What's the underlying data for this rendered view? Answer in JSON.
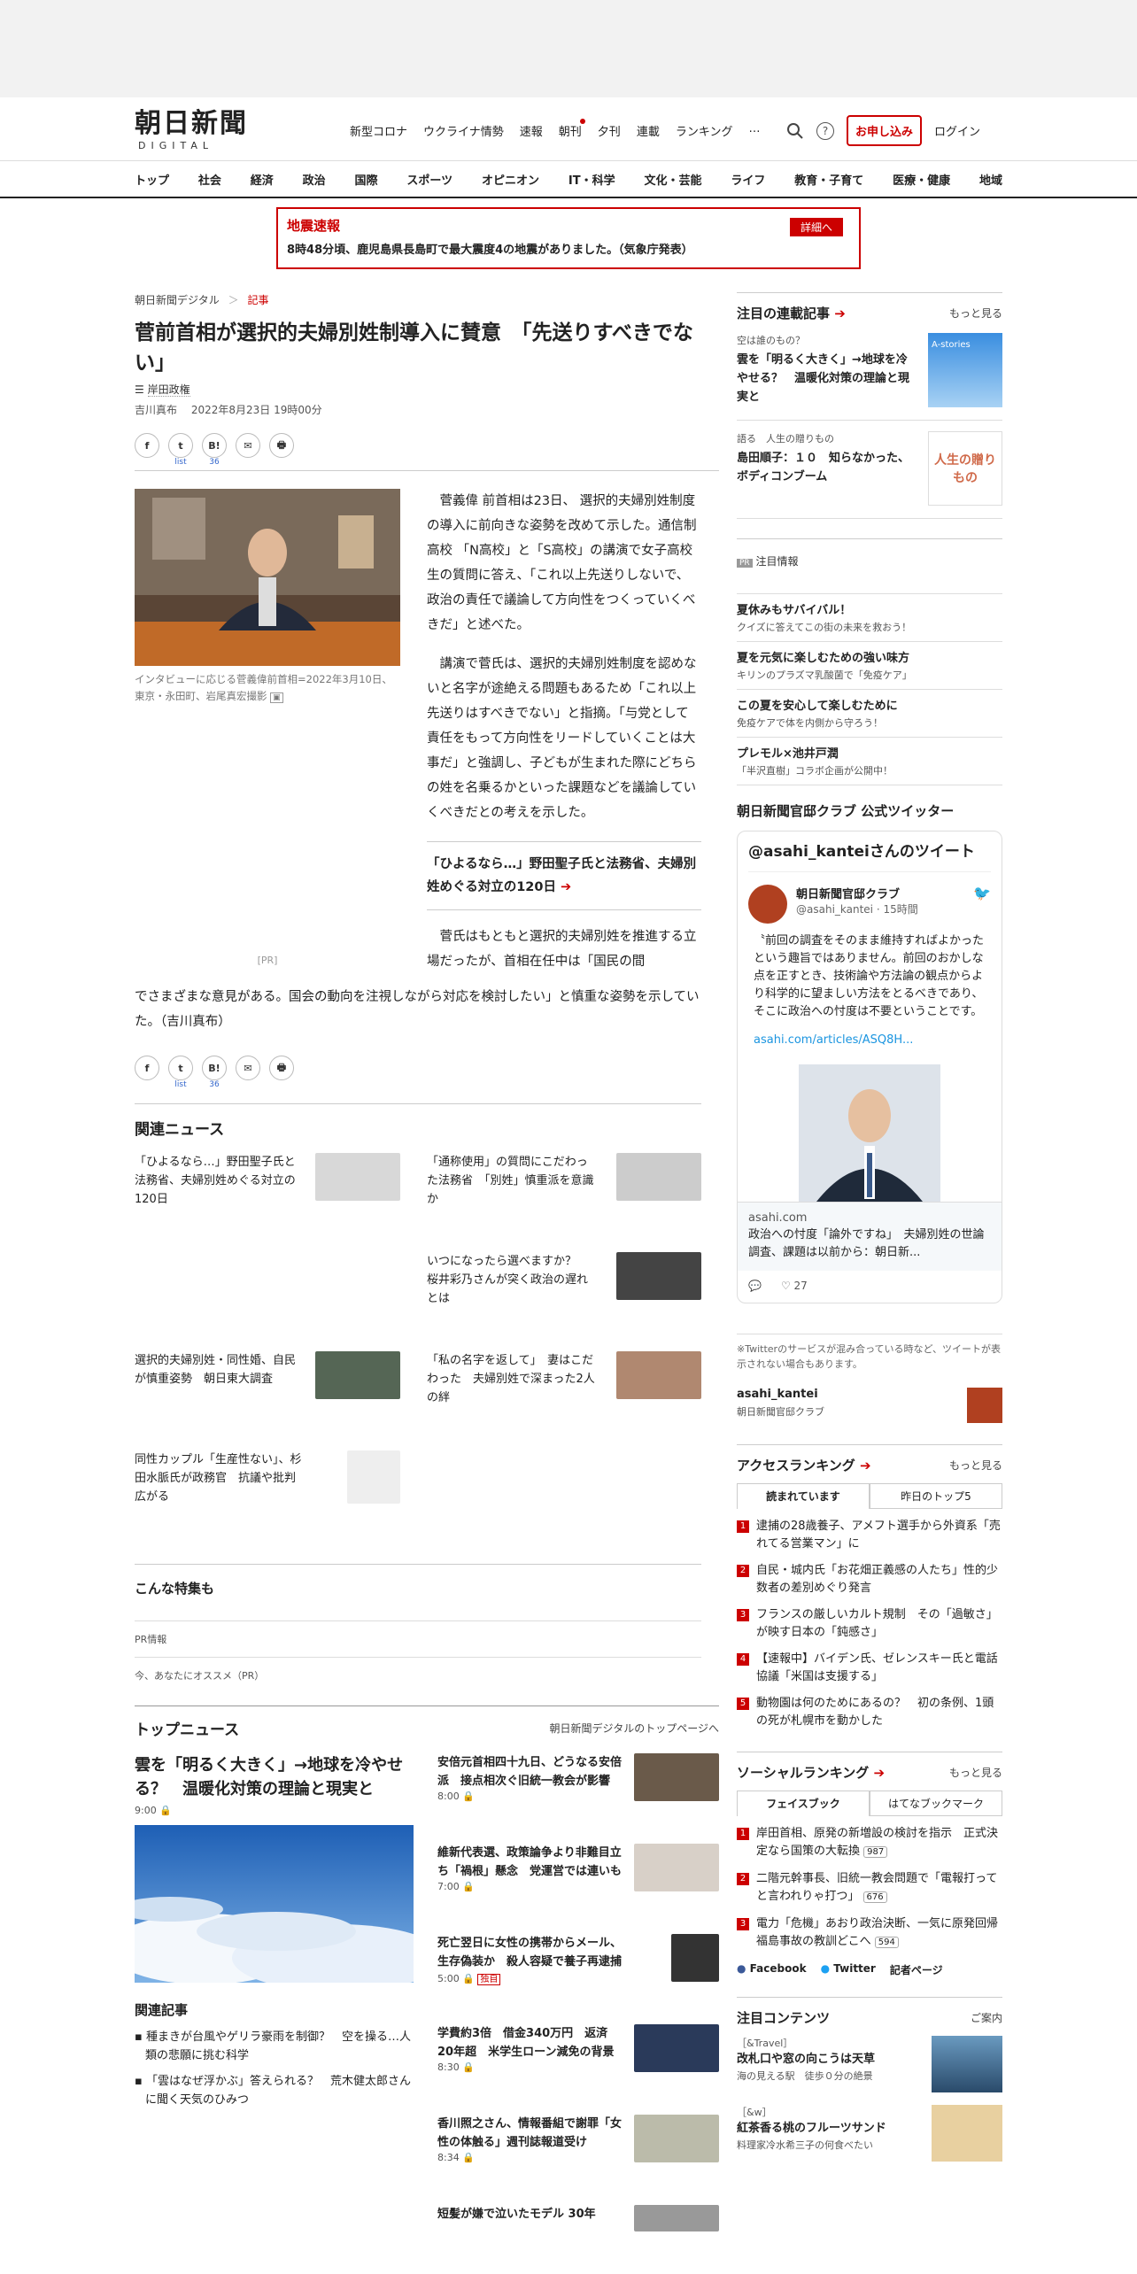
{
  "header": {
    "logo_main": "朝日新聞",
    "logo_sub": "DIGITAL",
    "nav": [
      "新型コロナ",
      "ウクライナ情勢",
      "速報",
      "朝刊",
      "夕刊",
      "連載",
      "ランキング",
      "…"
    ],
    "apply": "お申し込み",
    "login": "ログイン"
  },
  "categories": [
    "トップ",
    "社会",
    "経済",
    "政治",
    "国際",
    "スポーツ",
    "オピニオン",
    "IT・科学",
    "文化・芸能",
    "ライフ",
    "教育・子育て",
    "医療・健康",
    "地域"
  ],
  "alert": {
    "title": "地震速報",
    "button": "詳細へ",
    "text": "8時48分頃、鹿児島県長島町で最大震度4の地震がありました。（気象庁発表）"
  },
  "article": {
    "crumb_site": "朝日新聞デジタル",
    "crumb_sep": "＞",
    "crumb_section": "記事",
    "title": "菅前首相が選択的夫婦別姓制導入に賛意　「先送りすべきでない」",
    "tag": "岸田政権",
    "author": "吉川真布",
    "date": "2022年8月23日 19時00分",
    "share_icons": [
      "f",
      "t",
      "B!",
      "✉",
      "🖶"
    ],
    "share_sub_twitter": "list",
    "share_sub_hatena": "36",
    "photo_caption": "インタビューに応じる菅義偉前首相=2022年3月10日、東京・永田町、岩尾真宏撮影",
    "p1": "菅義偉 前首相は23日、 選択的夫婦別姓制度の導入に前向きな姿勢を改めて示した。通信制高校 「N高校」と「S高校」の講演で女子高校生の質問に答え、「これ以上先送りしないで、政治の責任で議論して方向性をつくっていくべきだ」と述べた。",
    "p2": "講演で菅氏は、選択的夫婦別姓制度を認めないと名字が途絶える問題もあるため「これ以上先送りはすべきでない」と指摘。「与党として責任をもって方向性をリードしていくことは大事だ」と強調し、子どもが生まれた際にどちらの姓を名乗るかといった課題などを議論していくべきだとの考えを示した。",
    "related_box": "「ひよるなら…」野田聖子氏と法務省、夫婦別姓めぐる対立の120日",
    "pr": "[PR]",
    "p3a": "菅氏はもともと選択的夫婦別姓を推進する立場だったが、首相在任中は「国民の間",
    "p3b": "でさまざまな意見がある。国会の動向を注視しながら対応を検討したい」と慎重な姿勢を示していた。（吉川真布）"
  },
  "related_news": {
    "heading": "関連ニュース",
    "items": [
      "「ひよるなら…」野田聖子氏と法務省、夫婦別姓めぐる対立の120日",
      "「通称使用」の質問にこだわった法務省　「別姓」慎重派を意識か",
      "いつになったら選べますか？　桜井彩乃さんが突く政治の遅れとは",
      "選択的夫婦別姓・同性婚、自民が慎重姿勢　朝日東大調査",
      "「私の名字を返して」　妻はこだわった　夫婦別姓で深まった2人の絆",
      "同性カップル「生産性ない」、杉田水脈氏が政務官　抗議や批判広がる"
    ]
  },
  "features": {
    "heading": "こんな特集も",
    "pr_info": "PR情報",
    "recommend": "今、あなたにオススメ（PR）"
  },
  "top_news": {
    "heading": "トップニュース",
    "more": "朝日新聞デジタルのトップページへ",
    "lead_title": "雲を「明るく大きく」→地球を冷やせる？　温暖化対策の理論と現実と",
    "lead_time": "9:00",
    "related_heading": "関連記事",
    "related": [
      "種まきが台風やゲリラ豪雨を制御？　空を操る…人類の悲願に挑む科学",
      "「雲はなぜ浮かぶ」答えられる？　荒木健太郎さんに聞く天気のひみつ"
    ],
    "items": [
      {
        "title": "安倍元首相四十九日、どうなる安倍派　接点相次ぐ旧統一教会が影響",
        "time": "8:00",
        "badge": ""
      },
      {
        "title": "維新代表選、政策論争より非難目立ち「禍根」懸念　党運営では連いも",
        "time": "7:00",
        "badge": ""
      },
      {
        "title": "死亡翌日に女性の携帯からメール、生存偽装か　殺人容疑で養子再逮捕",
        "time": "5:00",
        "badge": "独自"
      },
      {
        "title": "学費約3倍　借金340万円　返済20年超　米学生ローン減免の背景",
        "time": "8:30",
        "badge": ""
      },
      {
        "title": "香川照之さん、情報番組で謝罪「女性の体触る」週刊誌報道受け",
        "time": "8:34",
        "badge": ""
      },
      {
        "title": "短髪が嫌で泣いたモデル 30年",
        "time": "",
        "badge": ""
      }
    ]
  },
  "sidebar": {
    "serial_heading": "注目の連載記事",
    "serial_more": "もっと見る",
    "serials": [
      {
        "kicker": "空は誰のもの？",
        "title": "雲を「明るく大きく」→地球を冷やせる？　温暖化対策の理論と現実と",
        "thumb_label": "A-stories"
      },
      {
        "kicker": "語る　人生の贈りもの",
        "title": "島田順子：１０　知らなかった、ボディコンブーム",
        "thumb_label": "人生の贈りもの"
      }
    ],
    "promo_heading": "注目情報",
    "promo_badge": "PR",
    "promos": [
      {
        "title": "夏休みもサバイバル！",
        "sub": "クイズに答えてこの街の未来を救おう！"
      },
      {
        "title": "夏を元気に楽しむための強い味方",
        "sub": "キリンのプラズマ乳酸菌で「免疫ケア」"
      },
      {
        "title": "この夏を安心して楽しむために",
        "sub": "免疫ケアで体を内側から守ろう！"
      },
      {
        "title": "プレモル×池井戸潤",
        "sub": "「半沢直樹」コラボ企画が公開中！"
      }
    ],
    "twitter_heading": "朝日新聞官邸クラブ 公式ツイッター",
    "tw_box_title": "@asahi_kanteiさんのツイート",
    "tw_name": "朝日新聞官邸クラブ",
    "tw_handle": "@asahi_kantei · 15時間",
    "tw_text": "〝前回の調査をそのまま維持すればよかったという趣旨ではありません。前回のおかしな点を正すとき、技術論や方法論の観点からより科学的に望ましい方法をとるべきであり、そこに政治への忖度は不要ということです。",
    "tw_link": "asahi.com/articles/ASQ8H...",
    "tw_card_domain": "asahi.com",
    "tw_card_title": "政治への忖度「論外ですね」　夫婦別姓の世論調査、課題は以前から：朝日新...",
    "tw_likes": "27",
    "tw_note": "※Twitterのサービスが混み合っている時など、ツイートが表示されない場合もあります。",
    "tw_account": "asahi_kantei",
    "tw_account_sub": "朝日新聞官邸クラブ",
    "access_heading": "アクセスランキング",
    "access_more": "もっと見る",
    "access_tabs": [
      "読まれています",
      "昨日のトップ5"
    ],
    "access": [
      "逮捕の28歳養子、アメフト選手から外資系「売れてる営業マン」に",
      "自民・城内氏「お花畑正義感の人たち」性的少数者の差別めぐり発言",
      "フランスの厳しいカルト規制　その「過敏さ」が映す日本の「鈍感さ」",
      "【速報中】バイデン氏、ゼレンスキー氏と電話協議「米国は支援する」",
      "動物園は何のためにあるの？　初の条例、1頭の死が札幌市を動かした"
    ],
    "social_heading": "ソーシャルランキング",
    "social_more": "もっと見る",
    "social_tabs": [
      "フェイスブック",
      "はてなブックマーク"
    ],
    "social": [
      {
        "title": "岸田首相、原発の新増設の検討を指示　正式決定なら国策の大転換",
        "count": "987"
      },
      {
        "title": "二階元幹事長、旧統一教会問題で「電報打ってと言われりゃ打つ」",
        "count": "676"
      },
      {
        "title": "電力「危機」あおり政治決断、一気に原発回帰　福島事故の教訓どこへ",
        "count": "594"
      }
    ],
    "social_links": [
      "Facebook",
      "Twitter",
      "記者ページ"
    ],
    "content_heading": "注目コンテンツ",
    "content_more": "ご案内",
    "contents": [
      {
        "kicker": "［&Travel］",
        "title": "改札口や窓の向こうは天草",
        "sub": "海の見える駅　徒歩０分の絶景"
      },
      {
        "kicker": "［&w］",
        "title": "紅茶香る桃のフルーツサンド",
        "sub": "料理家冷水希三子の何食べたい"
      }
    ]
  }
}
